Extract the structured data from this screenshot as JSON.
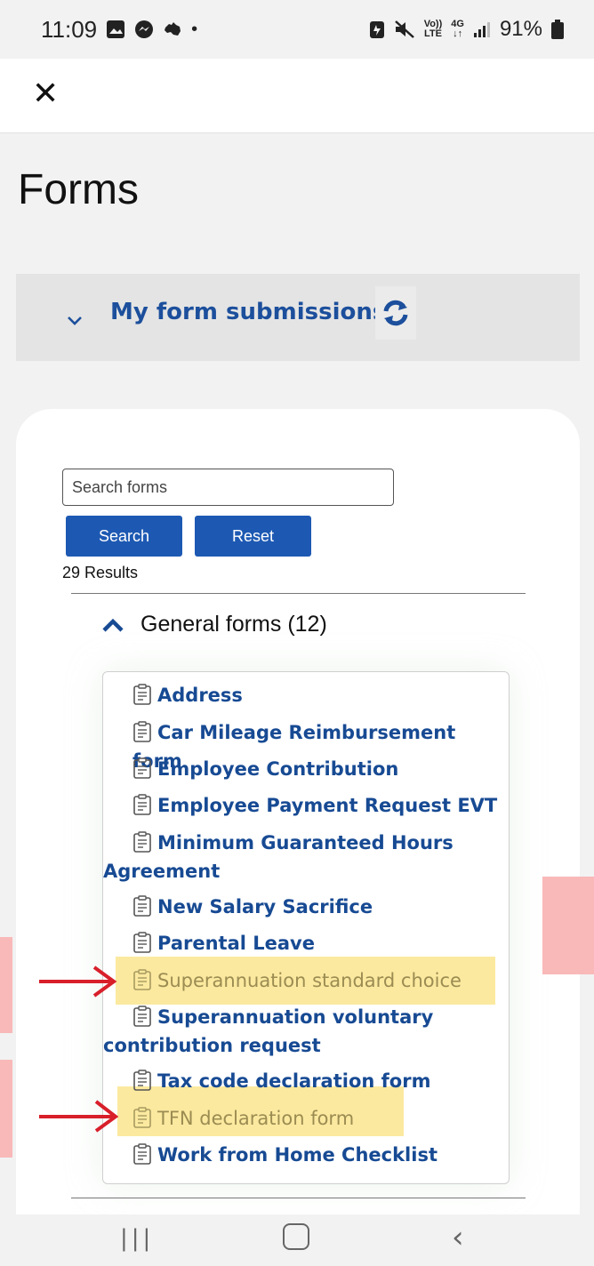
{
  "status_bar": {
    "time": "11:09",
    "battery": "91%",
    "volte": "Vo))",
    "lte": "LTE",
    "network": "4G"
  },
  "page": {
    "title": "Forms"
  },
  "submissions": {
    "label": "My form submissions"
  },
  "search": {
    "placeholder": "Search forms",
    "search_label": "Search",
    "reset_label": "Reset",
    "results": "29 Results"
  },
  "group": {
    "title": "General forms (12)"
  },
  "forms": [
    {
      "line1": "Address"
    },
    {
      "line1": "Car Mileage Reimbursement form"
    },
    {
      "line1": "Employee Contribution"
    },
    {
      "line1": "Employee Payment Request EVT"
    },
    {
      "line1": "Minimum Guaranteed Hours",
      "line2": "Agreement"
    },
    {
      "line1": "New Salary Sacrifice"
    },
    {
      "line1": "Parental Leave"
    },
    {
      "line1": "Superannuation standard choice",
      "highlighted": true
    },
    {
      "line1": "Superannuation voluntary",
      "line2": "contribution request"
    },
    {
      "line1": "Tax code declaration form"
    },
    {
      "line1": "TFN declaration form",
      "highlighted": true
    },
    {
      "line1": "Work from Home Checklist"
    }
  ],
  "colors": {
    "accent": "#1d59b3",
    "link": "#174a93",
    "highlight": "#fbe89a",
    "arrow": "#d81f2a"
  }
}
